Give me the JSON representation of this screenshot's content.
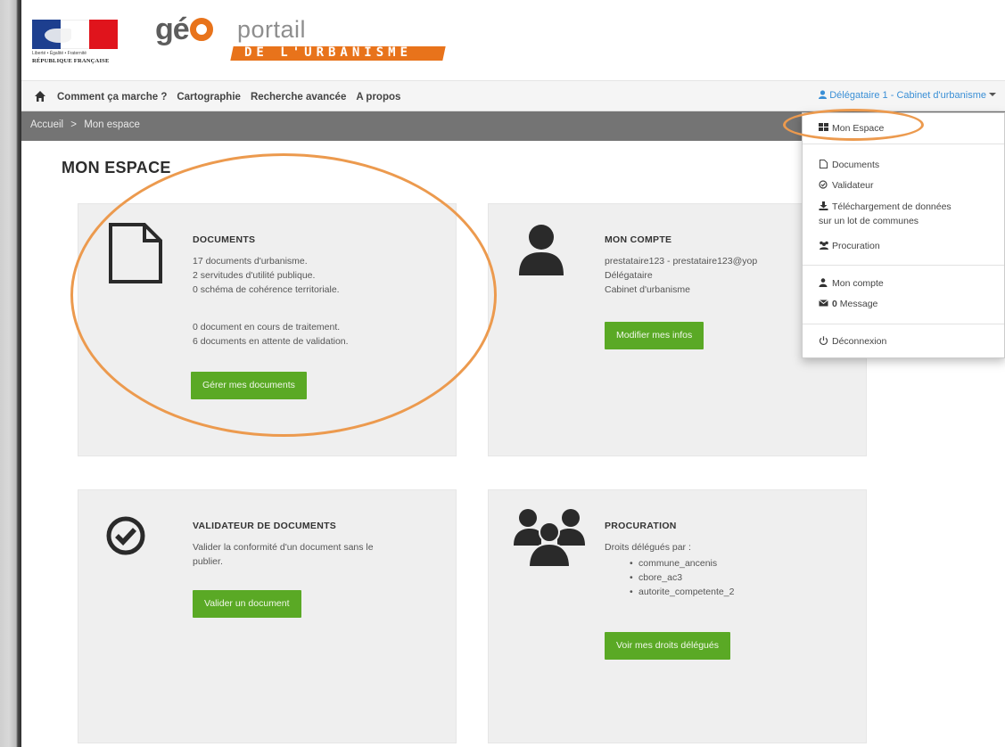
{
  "header": {
    "rf_motto": "Liberté • Égalité • Fraternité",
    "rf_name": "RÉPUBLIQUE FRANÇAISE",
    "logo_ge": "gé",
    "logo_portail": "portail",
    "logo_band": "DE L'URBANISME"
  },
  "nav": {
    "items": [
      "Comment ça marche ?",
      "Cartographie",
      "Recherche avancée",
      "A propos"
    ],
    "user": "Délégataire 1 - Cabinet d'urbanisme"
  },
  "breadcrumb": {
    "home": "Accueil",
    "separator": ">",
    "current": "Mon espace"
  },
  "page_title": "MON ESPACE",
  "cards": {
    "documents": {
      "title": "DOCUMENTS",
      "lines": [
        "17 documents d'urbanisme.",
        "2 servitudes d'utilité publique.",
        "0 schéma de cohérence territoriale.",
        "0 document en cours de traitement.",
        "6 documents en attente de validation."
      ],
      "button": "Gérer mes documents"
    },
    "compte": {
      "title": "MON COMPTE",
      "lines": [
        "prestataire123 - prestataire123@yop",
        "Délégataire",
        "Cabinet d'urbanisme"
      ],
      "button": "Modifier mes infos"
    },
    "validateur": {
      "title": "VALIDATEUR DE DOCUMENTS",
      "lines": [
        "Valider la conformité d'un document sans le",
        "publier."
      ],
      "button": "Valider un document"
    },
    "procuration": {
      "title": "PROCURATION",
      "intro": "Droits délégués par :",
      "items": [
        "commune_ancenis",
        "cbore_ac3",
        "autorite_competente_2"
      ],
      "button": "Voir mes droits délégués"
    }
  },
  "dropdown": {
    "mon_espace": "Mon Espace",
    "documents": "Documents",
    "validateur": "Validateur",
    "telechargement_1": "Téléchargement de données",
    "telechargement_2": "sur un lot de communes",
    "procuration": "Procuration",
    "mon_compte": "Mon compte",
    "message_count": "0",
    "message": "Message",
    "deconnexion": "Déconnexion"
  },
  "colors": {
    "accent_orange": "#e8731b",
    "annotation_orange": "#ec9a4e",
    "button_green": "#5aa925",
    "link_blue": "#3a8fd6",
    "breadcrumb_gray": "#747474",
    "card_bg": "#efefef"
  }
}
